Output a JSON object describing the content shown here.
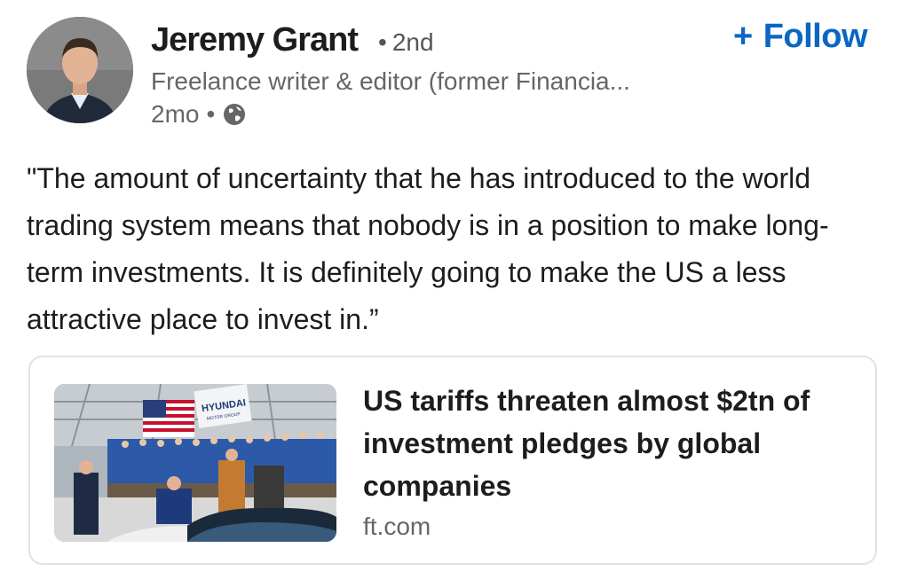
{
  "author": {
    "name": "Jeremy Grant",
    "degree": "2nd",
    "headline": "Freelance writer & editor (former Financia...",
    "time": "2mo",
    "visibility_icon": "globe-icon"
  },
  "follow_button": {
    "label": "Follow",
    "icon": "plus-icon",
    "color": "#0a66c2"
  },
  "post": {
    "text": "\"The amount of uncertainty that he has introduced to the world trading system means that nobody is in a position to make long-term investments. It is definitely going to make the US a less attractive place to invest in.”"
  },
  "article": {
    "title": "US tariffs threaten almost $2tn of investment pledges by global companies",
    "source": "ft.com",
    "thumbnail_sign": "HYUNDAI",
    "thumbnail_sign_sub": "MOTOR GROUP"
  }
}
